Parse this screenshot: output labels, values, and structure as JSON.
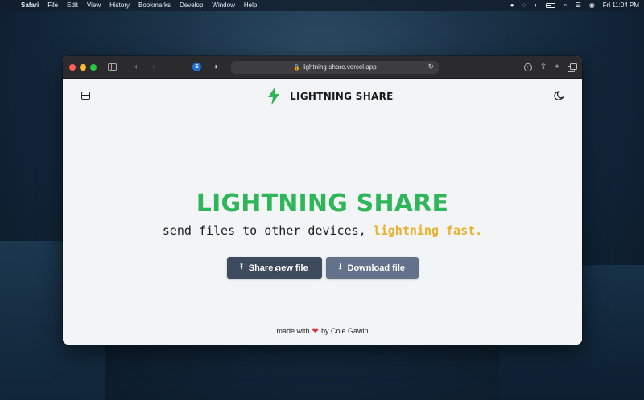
{
  "menubar": {
    "app_name": "Safari",
    "items": [
      "File",
      "Edit",
      "View",
      "History",
      "Bookmarks",
      "Develop",
      "Window",
      "Help"
    ],
    "clock": "Fri 11:04 PM"
  },
  "browser": {
    "url": "lightning-share.vercel.app"
  },
  "site": {
    "brand": "LIGHTNING SHARE",
    "hero_title": "LIGHTNING SHARE",
    "hero_sub_plain": "send files to other devices, ",
    "hero_sub_accent": "lightning fast.",
    "share_button": "Share new file",
    "download_button": "Download file",
    "footer_pre": "made with",
    "footer_post": "by Cole Gawin"
  },
  "colors": {
    "brand_green": "#2fb65a",
    "accent_yellow": "#e6b12c",
    "primary_button": "#3e4a5e",
    "secondary_button": "#63728a"
  }
}
